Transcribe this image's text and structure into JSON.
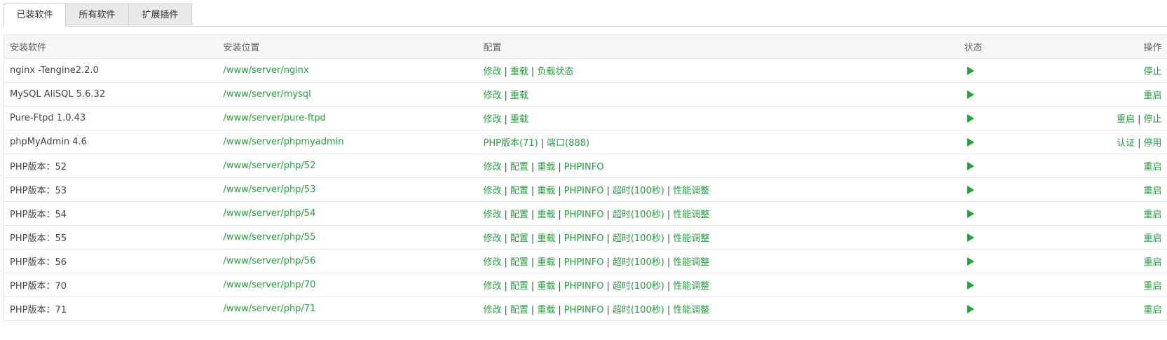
{
  "tabs": [
    {
      "label": "已装软件",
      "active": true
    },
    {
      "label": "所有软件",
      "active": false
    },
    {
      "label": "扩展插件",
      "active": false
    }
  ],
  "table": {
    "headers": [
      "安装软件",
      "安装位置",
      "配置",
      "状态",
      "操作"
    ],
    "rows": [
      {
        "name": "nginx -Tengine2.2.0",
        "path": "/www/server/nginx",
        "config": [
          "修改",
          "重载",
          "负载状态"
        ],
        "status_icon": "play-icon",
        "actions": [
          "停止"
        ]
      },
      {
        "name": "MySQL AliSQL 5.6.32",
        "path": "/www/server/mysql",
        "config": [
          "修改",
          "重载"
        ],
        "status_icon": "play-icon",
        "actions": [
          "重启"
        ]
      },
      {
        "name": "Pure-Ftpd 1.0.43",
        "path": "/www/server/pure-ftpd",
        "config": [
          "修改",
          "重载"
        ],
        "status_icon": "play-icon",
        "actions": [
          "重启",
          "停止"
        ]
      },
      {
        "name": "phpMyAdmin 4.6",
        "path": "/www/server/phpmyadmin",
        "config": [
          "PHP版本(71)",
          "端口(888)"
        ],
        "status_icon": "play-icon",
        "actions": [
          "认证",
          "停用"
        ]
      },
      {
        "name": "PHP版本：52",
        "path": "/www/server/php/52",
        "config": [
          "修改",
          "配置",
          "重载",
          "PHPINFO"
        ],
        "status_icon": "play-icon",
        "actions": [
          "重启"
        ]
      },
      {
        "name": "PHP版本：53",
        "path": "/www/server/php/53",
        "config": [
          "修改",
          "配置",
          "重载",
          "PHPINFO",
          "超时(100秒)",
          "性能调整"
        ],
        "status_icon": "play-icon",
        "actions": [
          "重启"
        ]
      },
      {
        "name": "PHP版本：54",
        "path": "/www/server/php/54",
        "config": [
          "修改",
          "配置",
          "重载",
          "PHPINFO",
          "超时(100秒)",
          "性能调整"
        ],
        "status_icon": "play-icon",
        "actions": [
          "重启"
        ]
      },
      {
        "name": "PHP版本：55",
        "path": "/www/server/php/55",
        "config": [
          "修改",
          "配置",
          "重载",
          "PHPINFO",
          "超时(100秒)",
          "性能调整"
        ],
        "status_icon": "play-icon",
        "actions": [
          "重启"
        ]
      },
      {
        "name": "PHP版本：56",
        "path": "/www/server/php/56",
        "config": [
          "修改",
          "配置",
          "重载",
          "PHPINFO",
          "超时(100秒)",
          "性能调整"
        ],
        "status_icon": "play-icon",
        "actions": [
          "重启"
        ]
      },
      {
        "name": "PHP版本：70",
        "path": "/www/server/php/70",
        "config": [
          "修改",
          "配置",
          "重载",
          "PHPINFO",
          "超时(100秒)",
          "性能调整"
        ],
        "status_icon": "play-icon",
        "actions": [
          "重启"
        ]
      },
      {
        "name": "PHP版本：71",
        "path": "/www/server/php/71",
        "config": [
          "修改",
          "配置",
          "重载",
          "PHPINFO",
          "超时(100秒)",
          "性能调整"
        ],
        "status_icon": "play-icon",
        "actions": [
          "重启"
        ]
      }
    ]
  },
  "colors": {
    "accent": "#20a53a",
    "border": "#e4e4e4",
    "header_bg": "#f6f6f6"
  }
}
